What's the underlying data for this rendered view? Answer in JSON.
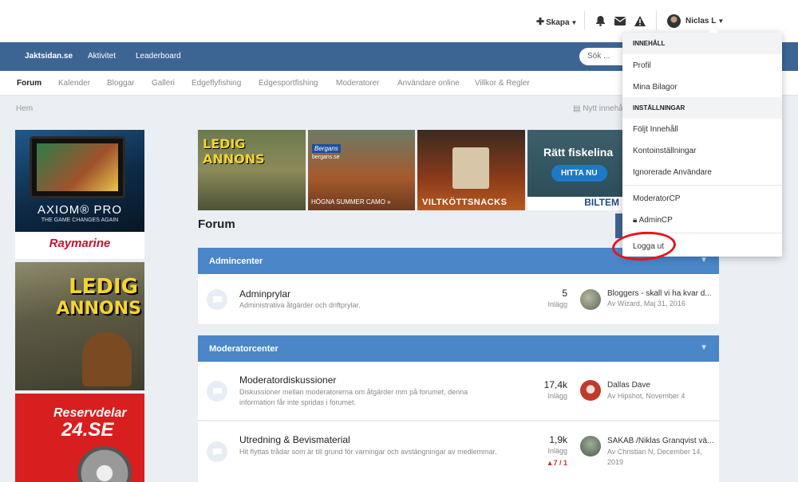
{
  "userbar": {
    "create_label": "Skapa",
    "user_name": "Niclas L"
  },
  "mainnav": {
    "items": [
      "Jaktsidan.se",
      "Aktivitet",
      "Leaderboard"
    ],
    "search_placeholder": "Sök ..."
  },
  "subnav": {
    "items": [
      "Forum",
      "Kalender",
      "Bloggar",
      "Galleri",
      "Edgeflyfishing",
      "Edgesportfishing",
      "Moderatorer",
      "Användare online",
      "Villkor & Regler"
    ]
  },
  "breadcrumb": "Hem",
  "unread_link": "Nytt innehå",
  "ads": {
    "axiom_title": "AXIOM® PRO",
    "axiom_tagline": "THE GAME CHANGES AGAIN",
    "axiom_brand": "Raymarine",
    "ledig_line1": "LEDIG",
    "ledig_line2": "ANNONS",
    "reserv_line1": "Reservdelar",
    "reserv_line2": "24.SE",
    "banner1": "LEDIG ANNONS",
    "banner2_logo": "Bergans",
    "banner2_sub": "bergans.se",
    "banner2_text": "HÖGNA SUMMER CAMO »",
    "banner3": "VILTKÖTTSNACKS",
    "banner4_title": "Rätt fiskelina",
    "banner4_button": "HITTA NU",
    "banner4_brand": "BILTEM"
  },
  "page_title": "Forum",
  "sections": [
    {
      "title": "Admincenter",
      "forums": [
        {
          "title": "Adminprylar",
          "desc": "Administrativa åtgärder och driftprylar.",
          "count": "5",
          "count_label": "Inlägg",
          "last_title": "Bloggers - skall vi ha kvar d...",
          "last_by": "Av Wizard, Maj 31, 2016"
        }
      ]
    },
    {
      "title": "Moderatorcenter",
      "forums": [
        {
          "title": "Moderatordiskussioner",
          "desc": "Diskussioner mellan moderatorerna om åtgärder mm på forumet, denna information får inte spridas i forumet.",
          "count": "17,4k",
          "count_label": "Inlägg",
          "last_title": "Dallas Dave",
          "last_by": "Av Hipshot, November 4"
        },
        {
          "title": "Utredning & Bevismaterial",
          "desc": "Hit flyttas trådar som är till grund för varningar och avstängningar av medlemmar.",
          "count": "1,9k",
          "count_label": "Inlägg",
          "warn": "7 / 1",
          "last_title": "SAKAB /Niklas Granqvist vä...",
          "last_by": "Av Christian N, December 14, 2019"
        }
      ]
    }
  ],
  "dropdown": {
    "head1": "INNEHÅLL",
    "profile": "Profil",
    "attachments": "Mina Bilagor",
    "head2": "INSTÄLLNINGAR",
    "followed": "Följt Innehåll",
    "account_settings": "Kontoinställningar",
    "ignored": "Ignorerade Användare",
    "modcp": "ModeratorCP",
    "admincp": "AdminCP",
    "logout": "Logga ut"
  },
  "colors": {
    "nav_blue": "#3d6594",
    "section_blue": "#4a86c8",
    "annotation_red": "#e8141c"
  }
}
